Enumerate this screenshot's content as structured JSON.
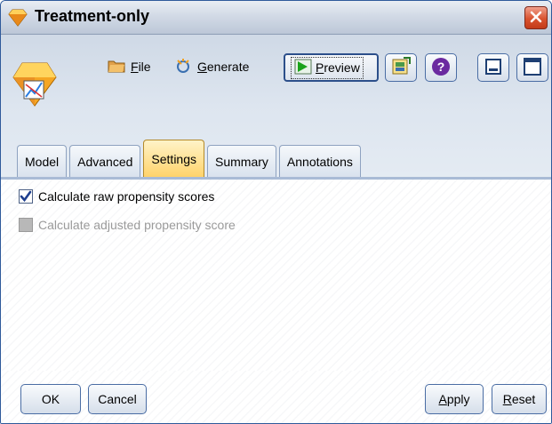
{
  "window": {
    "title": "Treatment-only",
    "accent_color": "#2f5a9b",
    "title_icon": "diamond-node-icon",
    "close_icon": "close-icon"
  },
  "toolbar": {
    "node_icon": "propensity-model-node-icon",
    "file_label_u": "F",
    "file_label_rest": "ile",
    "generate_label_u": "G",
    "generate_label_rest": "enerate",
    "preview_label_u": "P",
    "preview_label_rest": "review",
    "export_icon": "export-icon",
    "help_icon": "help-icon",
    "minimize_icon": "minimize-icon",
    "maximize_icon": "maximize-icon"
  },
  "tabs": [
    {
      "label": "Model",
      "active": false
    },
    {
      "label": "Advanced",
      "active": false
    },
    {
      "label": "Settings",
      "active": true
    },
    {
      "label": "Summary",
      "active": false
    },
    {
      "label": "Annotations",
      "active": false
    }
  ],
  "settings": {
    "raw_label": "Calculate raw propensity scores",
    "raw_checked": true,
    "adjusted_label": "Calculate adjusted propensity score",
    "adjusted_checked": false,
    "adjusted_enabled": false
  },
  "buttons": {
    "ok": "OK",
    "cancel": "Cancel",
    "apply_u": "A",
    "apply_rest": "pply",
    "reset_u": "R",
    "reset_rest": "eset"
  }
}
